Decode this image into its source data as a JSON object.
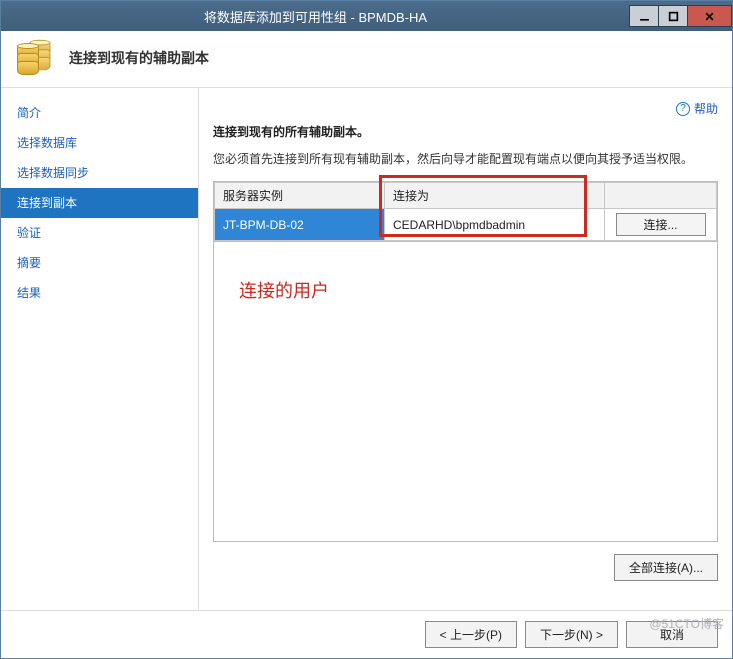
{
  "window": {
    "title": "将数据库添加到可用性组 - BPMDB-HA"
  },
  "header": {
    "title": "连接到现有的辅助副本"
  },
  "sidebar": {
    "items": [
      {
        "label": "简介",
        "selected": false
      },
      {
        "label": "选择数据库",
        "selected": false
      },
      {
        "label": "选择数据同步",
        "selected": false
      },
      {
        "label": "连接到副本",
        "selected": true
      },
      {
        "label": "验证",
        "selected": false
      },
      {
        "label": "摘要",
        "selected": false
      },
      {
        "label": "结果",
        "selected": false
      }
    ]
  },
  "content": {
    "help_label": "帮助",
    "subtitle": "连接到现有的所有辅助副本。",
    "description": "您必须首先连接到所有现有辅助副本，然后向导才能配置现有端点以便向其授予适当权限。",
    "table": {
      "headers": {
        "instance": "服务器实例",
        "connect_as": "连接为",
        "action": ""
      },
      "rows": [
        {
          "instance": "JT-BPM-DB-02",
          "connect_as": "CEDARHD\\bpmdbadmin",
          "action": "连接..."
        }
      ]
    },
    "annotation": "连接的用户",
    "connect_all": "全部连接(A)..."
  },
  "footer": {
    "prev": "< 上一步(P)",
    "next": "下一步(N) >",
    "cancel": "取消"
  },
  "watermark": "@51CTO博客"
}
